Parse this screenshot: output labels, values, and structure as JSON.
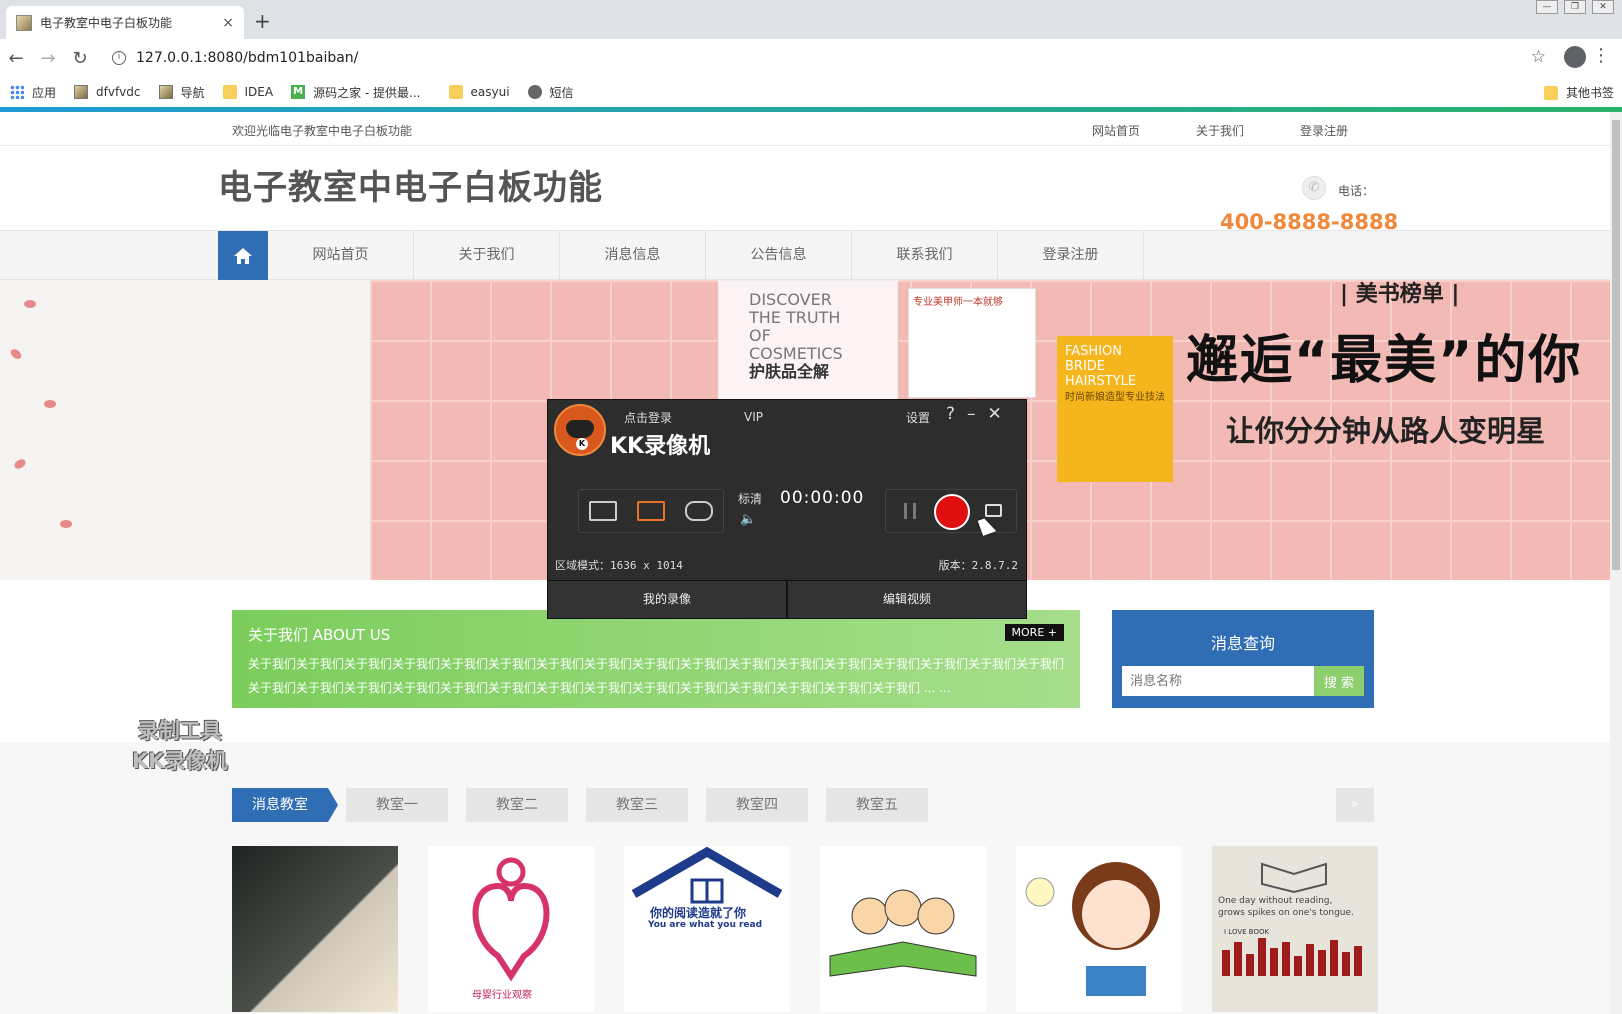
{
  "browser": {
    "tab_title": "电子教室中电子白板功能",
    "tab_close": "×",
    "new_tab": "+",
    "url": "127.0.0.1:8080/bdm101baiban/",
    "bookmarks": [
      "应用",
      "dfvfvdc",
      "导航",
      "IDEA",
      "源码之家 - 提供最...",
      "easyui",
      "短信"
    ],
    "bookmark_right": "其他书签"
  },
  "site": {
    "welcome": "欢迎光临电子教室中电子白板功能",
    "top_links": [
      "网站首页",
      "关于我们",
      "登录注册"
    ],
    "title": "电子教室中电子白板功能",
    "phone_label": "电话：",
    "phone_number": "400-8888-8888",
    "nav": [
      "网站首页",
      "关于我们",
      "消息信息",
      "公告信息",
      "联系我们",
      "登录注册"
    ]
  },
  "banner": {
    "top_text": "| 美书榜单 |",
    "headline": "邂逅“最美”的你",
    "sub": "让你分分钟从路人变明星",
    "book1": "DISCOVER THE TRUTH OF COSMETICS",
    "book1_cn": "护肤品全解",
    "book2": "专业美甲师一本就够",
    "book3": "FASHION BRIDE HAIRSTYLE",
    "book3_cn": "时尚新娘造型专业技法"
  },
  "about": {
    "title": "关于我们 ABOUT US",
    "more": "MORE +",
    "text": "关于我们关于我们关于我们关于我们关于我们关于我们关于我们关于我们关于我们关于我们关于我们关于我们关于我们关于我们关于我们关于我们关于我们关于我们关于我们关于我们关于我们关于我们关于我们关于我们关于我们关于我们关于我们关于我们关于我们关于我们关于我们 ... ..."
  },
  "search": {
    "title": "消息查询",
    "placeholder": "消息名称",
    "button": "搜 索"
  },
  "classrooms": {
    "tabs": [
      "消息教室",
      "教室一",
      "教室二",
      "教室三",
      "教室四",
      "教室五"
    ],
    "next": "»",
    "thumb3_text1": "你的阅读造就了你",
    "thumb3_text2": "You are what you read",
    "thumb2_text": "母婴行业观察",
    "thumb6_text1": "One day without reading,",
    "thumb6_text2": "grows spikes on one's tongue.",
    "thumb6_text3": "I LOVE BOOK"
  },
  "watermark": [
    "录制工具",
    "KK录像机"
  ],
  "kk": {
    "login": "点击登录",
    "vip": "VIP",
    "brand": "KK录像机",
    "settings": "设置",
    "help": "?",
    "minimize": "–",
    "close": "✕",
    "quality": "标清",
    "timer": "00:00:00",
    "speaker": "🔈",
    "mode_info": "区域模式：1636 x 1014",
    "version": "版本：2.8.7.2",
    "my_recordings": "我的录像",
    "edit_video": "编辑视频"
  },
  "colors": {
    "nav_blue": "#2f6db5",
    "about_green": "#7ccd5c",
    "phone_orange": "#f0883c",
    "record_red": "#e01010"
  }
}
